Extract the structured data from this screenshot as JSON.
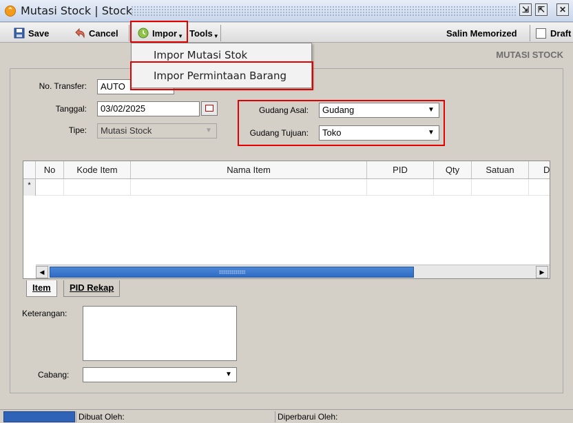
{
  "window": {
    "title": "Mutasi Stock | Stock",
    "icon": "app-logo-icon",
    "controls": [
      "restore-icon",
      "maximize-icon",
      "close-icon"
    ]
  },
  "toolbar": {
    "save_label": "Save",
    "cancel_label": "Cancel",
    "impor_label": "Impor",
    "tools_label": "Tools",
    "salin_label": "Salin Memorized",
    "draft_label": "Draft"
  },
  "impor_menu": {
    "items": [
      "Impor Mutasi Stok",
      "Impor Permintaan Barang"
    ]
  },
  "form": {
    "section_title": "MUTASI STOCK",
    "no_transfer_label": "No. Transfer:",
    "no_transfer_value": "AUTO",
    "tanggal_label": "Tanggal:",
    "tanggal_value": "03/02/2025",
    "tipe_label": "Tipe:",
    "tipe_value": "Mutasi Stock",
    "gudang_asal_label": "Gudang Asal:",
    "gudang_asal_value": "Gudang",
    "gudang_tujuan_label": "Gudang Tujuan:",
    "gudang_tujuan_value": "Toko"
  },
  "grid": {
    "columns": [
      "No",
      "Kode Item",
      "Nama Item",
      "PID",
      "Qty",
      "Satuan",
      "D"
    ],
    "new_row_marker": "*"
  },
  "tabs": [
    "Item",
    "PID Rekap"
  ],
  "bottom": {
    "keterangan_label": "Keterangan:",
    "cabang_label": "Cabang:",
    "cabang_value": ""
  },
  "status": {
    "dibuat_label": "Dibuat Oleh:",
    "diperbarui_label": "Diperbarui Oleh:"
  },
  "colors": {
    "highlight": "#e00000",
    "scroll_thumb": "#2f6bc3",
    "status_accent": "#2f63b8"
  }
}
